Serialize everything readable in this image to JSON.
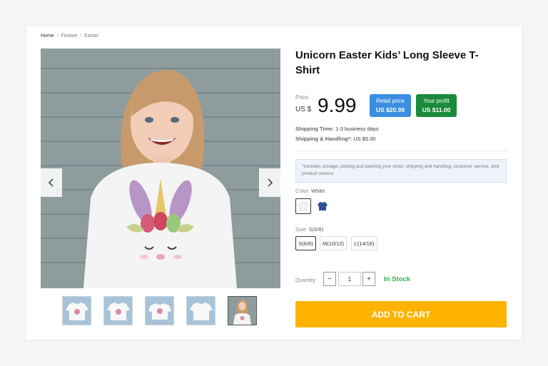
{
  "breadcrumb": {
    "home": "Home",
    "sep1": "/",
    "festive": "Festive",
    "sep2": "/",
    "easter": "Easter"
  },
  "product": {
    "title": "Unicorn Easter Kids’ Long Sleeve T-Shirt",
    "price_label": "Price",
    "currency": "US $",
    "price": "9.99",
    "retail_label": "Retail price",
    "retail_value": "US $20.99",
    "profit_label": "Your profit",
    "profit_value": "US $11.00",
    "shipping_time_label": "Shipping Time:",
    "shipping_time_value": "1-3 business days",
    "shipping_handling_label": "Shipping & Handling*:",
    "shipping_handling_value": "US $5.00",
    "note": "*Includes storage, picking and packing your order, shipping and handling, customer service, and product returns.",
    "color_label": "Color:",
    "color_value": "White",
    "size_label": "Size:",
    "size_value": "S(6/8)",
    "sizes": [
      "S(6/8)",
      "M(10/12)",
      "L(14/16)"
    ],
    "quantity_label": "Quantity:",
    "quantity": "1",
    "qty_minus": "−",
    "qty_plus": "+",
    "stock_status": "In Stock",
    "add_to_cart": "ADD TO CART"
  },
  "colors": {
    "retail_pill": "#3b8fe0",
    "profit_pill": "#1a8b3c",
    "cart_button": "#ffb300",
    "in_stock": "#2bb24c"
  },
  "icons": {
    "prev": "chevron-left-icon",
    "next": "chevron-right-icon"
  }
}
